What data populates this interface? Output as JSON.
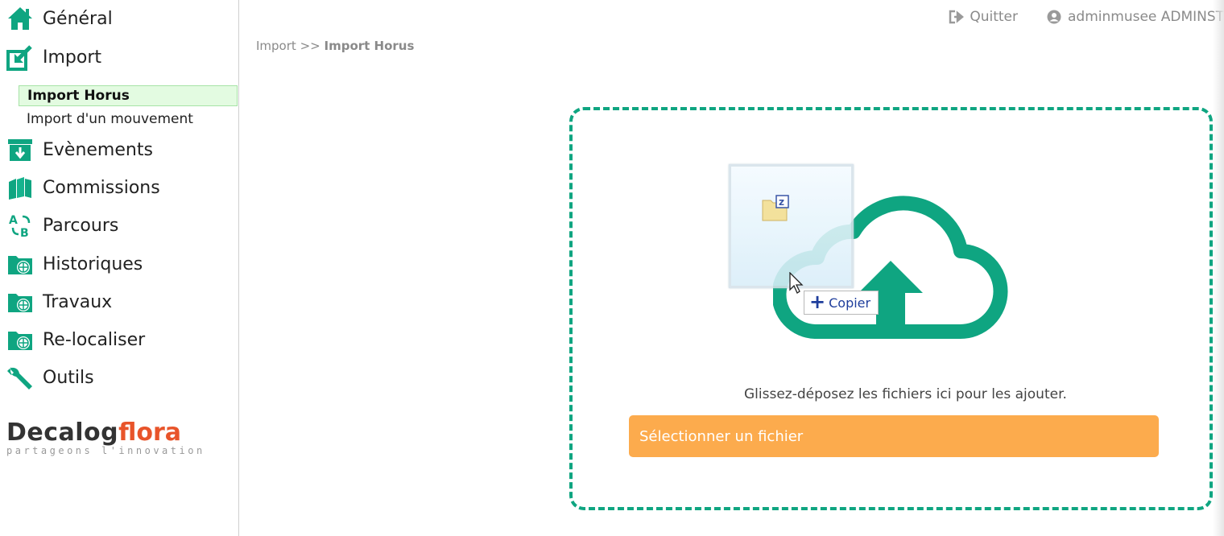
{
  "sidebar": {
    "items": [
      {
        "label": "Général",
        "icon": "home-icon"
      },
      {
        "label": "Import",
        "icon": "import-icon"
      },
      {
        "label": "Evènements",
        "icon": "archive-download-icon"
      },
      {
        "label": "Commissions",
        "icon": "books-icon"
      },
      {
        "label": "Parcours",
        "icon": "ab-icon"
      },
      {
        "label": "Historiques",
        "icon": "folder-globe-icon"
      },
      {
        "label": "Travaux",
        "icon": "folder-globe-icon"
      },
      {
        "label": "Re-localiser",
        "icon": "folder-globe-icon"
      },
      {
        "label": "Outils",
        "icon": "wrench-icon"
      }
    ],
    "sub_items": [
      {
        "label": "Import Horus",
        "active": true
      },
      {
        "label": "Import d'un mouvement",
        "active": false
      }
    ],
    "logo": {
      "brand1": "Decalog",
      "brand2": "flora",
      "tagline": "partageons l'innovation"
    }
  },
  "header": {
    "quit_label": "Quitter",
    "user_label": "adminmusee ADMINSTRA"
  },
  "breadcrumb": {
    "parent": "Import",
    "separator": ">>",
    "current": "Import Horus"
  },
  "dropzone": {
    "hint": "Glissez-déposez les fichiers ici pour les ajouter.",
    "select_button": "Sélectionner un fichier",
    "drag_tooltip": "Copier"
  },
  "colors": {
    "accent": "#0fa581",
    "button": "#fcab4d",
    "active_bg": "#e3fbe1",
    "logo_orange": "#e8542a"
  }
}
